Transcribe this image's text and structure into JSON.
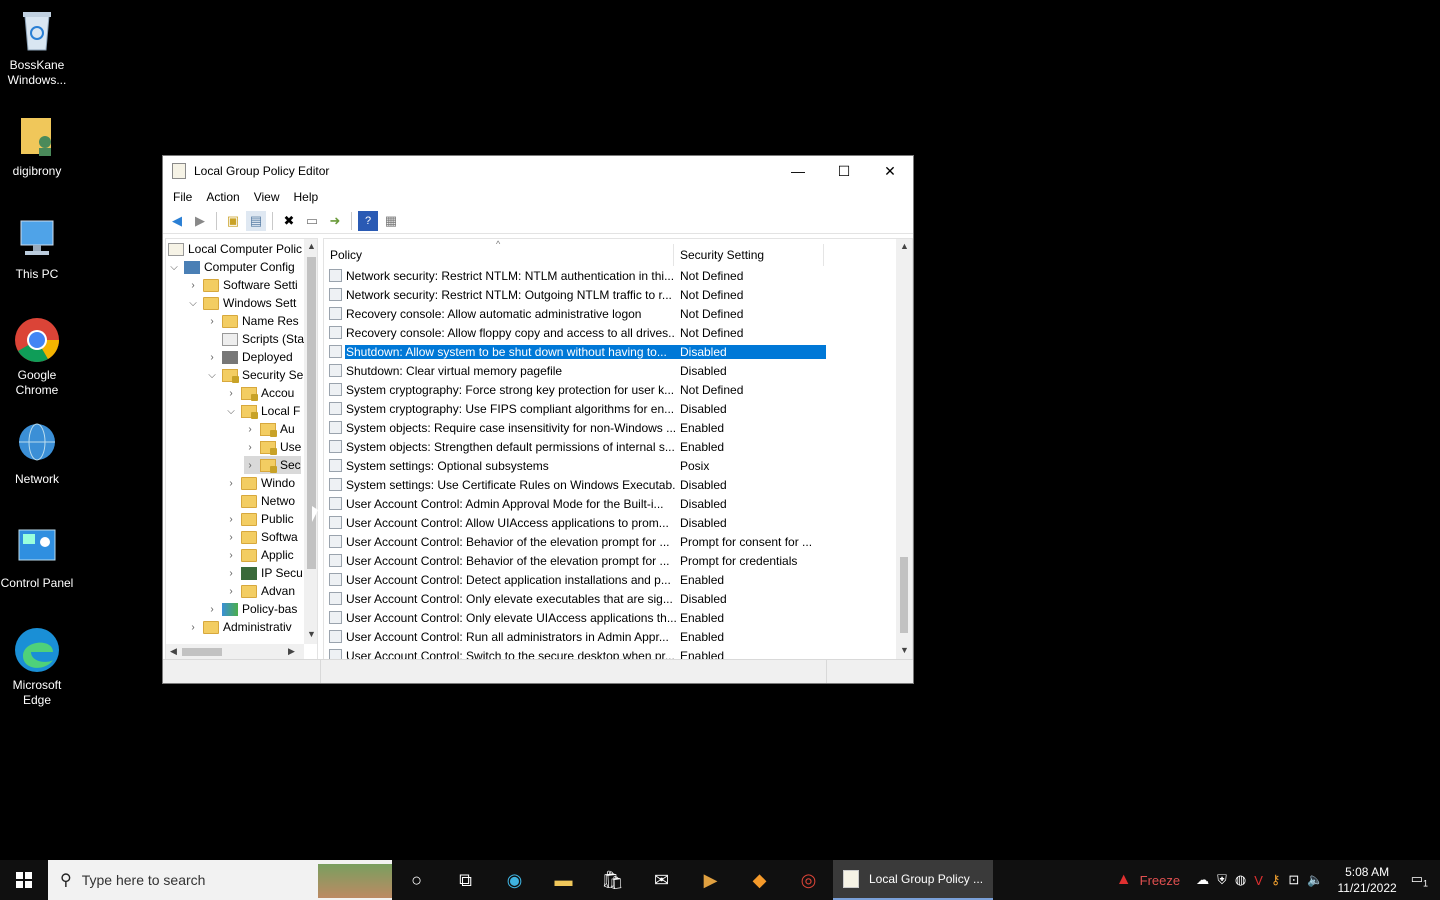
{
  "desktop": {
    "icons": [
      {
        "label": "BossKane Windows..."
      },
      {
        "label": "digibrony"
      },
      {
        "label": "This PC"
      },
      {
        "label": "Google Chrome"
      },
      {
        "label": "Network"
      },
      {
        "label": "Control Panel"
      },
      {
        "label": "Microsoft Edge"
      }
    ]
  },
  "window": {
    "title": "Local Group Policy Editor",
    "menu": [
      "File",
      "Action",
      "View",
      "Help"
    ],
    "tree": [
      {
        "label": "Local Computer Polic",
        "expand": ""
      },
      {
        "label": "Computer Config",
        "expand": "v"
      },
      {
        "label": "Software Setti",
        "expand": ">"
      },
      {
        "label": "Windows Sett",
        "expand": "v"
      },
      {
        "label": "Name Res",
        "expand": ">"
      },
      {
        "label": "Scripts (Sta",
        "expand": ""
      },
      {
        "label": "Deployed",
        "expand": ">"
      },
      {
        "label": "Security Se",
        "expand": "v"
      },
      {
        "label": "Accou",
        "expand": ">"
      },
      {
        "label": "Local F",
        "expand": "v"
      },
      {
        "label": "Au",
        "expand": ">"
      },
      {
        "label": "Use",
        "expand": ">"
      },
      {
        "label": "Sec",
        "expand": ">"
      },
      {
        "label": "Windo",
        "expand": ">"
      },
      {
        "label": "Netwo",
        "expand": ""
      },
      {
        "label": "Public",
        "expand": ">"
      },
      {
        "label": "Softwa",
        "expand": ">"
      },
      {
        "label": "Applic",
        "expand": ">"
      },
      {
        "label": "IP Secu",
        "expand": ">"
      },
      {
        "label": "Advan",
        "expand": ">"
      },
      {
        "label": "Policy-bas",
        "expand": ">"
      },
      {
        "label": "Administrativ",
        "expand": ">"
      }
    ],
    "columns": {
      "policy": "Policy",
      "setting": "Security Setting"
    },
    "rows": [
      {
        "policy": "Network security: Restrict NTLM: NTLM authentication in thi...",
        "setting": "Not Defined"
      },
      {
        "policy": "Network security: Restrict NTLM: Outgoing NTLM traffic to r...",
        "setting": "Not Defined"
      },
      {
        "policy": "Recovery console: Allow automatic administrative logon",
        "setting": "Not Defined"
      },
      {
        "policy": "Recovery console: Allow floppy copy and access to all drives...",
        "setting": "Not Defined"
      },
      {
        "policy": "Shutdown: Allow system to be shut down without having to...",
        "setting": "Disabled",
        "selected": true
      },
      {
        "policy": "Shutdown: Clear virtual memory pagefile",
        "setting": "Disabled"
      },
      {
        "policy": "System cryptography: Force strong key protection for user k...",
        "setting": "Not Defined"
      },
      {
        "policy": "System cryptography: Use FIPS compliant algorithms for en...",
        "setting": "Disabled"
      },
      {
        "policy": "System objects: Require case insensitivity for non-Windows ...",
        "setting": "Enabled"
      },
      {
        "policy": "System objects: Strengthen default permissions of internal s...",
        "setting": "Enabled"
      },
      {
        "policy": "System settings: Optional subsystems",
        "setting": "Posix"
      },
      {
        "policy": "System settings: Use Certificate Rules on Windows Executab...",
        "setting": "Disabled"
      },
      {
        "policy": "User Account Control: Admin Approval Mode for the Built-i...",
        "setting": "Disabled"
      },
      {
        "policy": "User Account Control: Allow UIAccess applications to prom...",
        "setting": "Disabled"
      },
      {
        "policy": "User Account Control: Behavior of the elevation prompt for ...",
        "setting": "Prompt for consent for ..."
      },
      {
        "policy": "User Account Control: Behavior of the elevation prompt for ...",
        "setting": "Prompt for credentials"
      },
      {
        "policy": "User Account Control: Detect application installations and p...",
        "setting": "Enabled"
      },
      {
        "policy": "User Account Control: Only elevate executables that are sig...",
        "setting": "Disabled"
      },
      {
        "policy": "User Account Control: Only elevate UIAccess applications th...",
        "setting": "Enabled"
      },
      {
        "policy": "User Account Control: Run all administrators in Admin Appr...",
        "setting": "Enabled"
      },
      {
        "policy": "User Account Control: Switch to the secure desktop when pr...",
        "setting": "Enabled"
      }
    ]
  },
  "taskbar": {
    "search_placeholder": "Type here to search",
    "active_app": "Local Group Policy ...",
    "freeze_label": "Freeze",
    "time": "5:08 AM",
    "date": "11/21/2022",
    "notification_count": "1"
  },
  "colors": {
    "selection": "#0078d7",
    "taskbar": "#101010"
  }
}
